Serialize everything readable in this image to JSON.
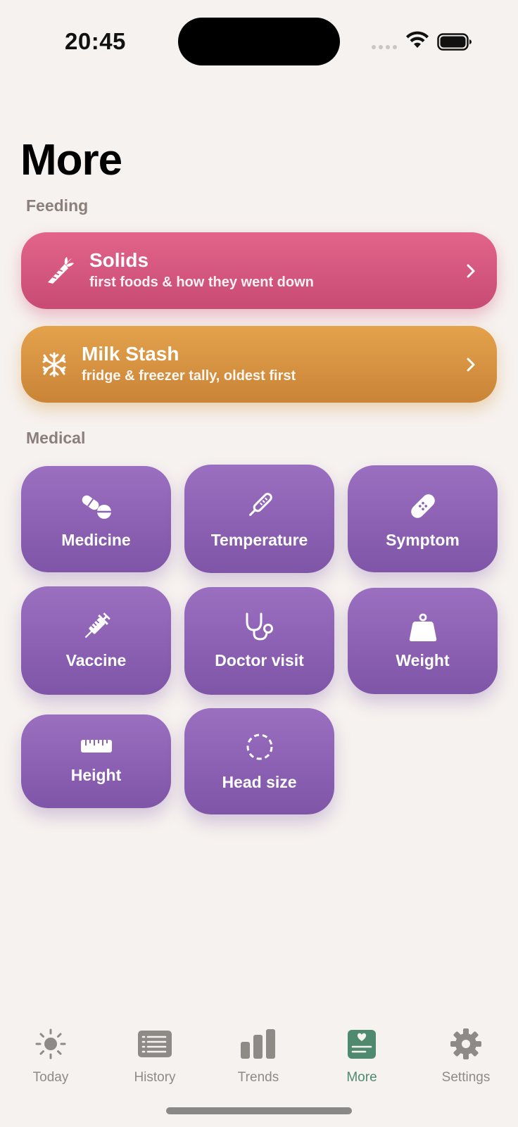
{
  "status_bar": {
    "time": "20:45"
  },
  "page": {
    "title": "More"
  },
  "feeding": {
    "header": "Feeding",
    "cards": [
      {
        "title": "Solids",
        "subtitle": "first foods & how they went down",
        "icon": "carrot-icon",
        "color": "#d9587f"
      },
      {
        "title": "Milk Stash",
        "subtitle": "fridge & freezer tally, oldest first",
        "icon": "snowflake-icon",
        "color": "#d9953f"
      }
    ]
  },
  "medical": {
    "header": "Medical",
    "color": "#8d62b5",
    "tiles": [
      {
        "label": "Medicine",
        "icon": "pills-icon"
      },
      {
        "label": "Temperature",
        "icon": "thermometer-icon"
      },
      {
        "label": "Symptom",
        "icon": "bandage-icon"
      },
      {
        "label": "Vaccine",
        "icon": "syringe-icon"
      },
      {
        "label": "Doctor visit",
        "icon": "stethoscope-icon"
      },
      {
        "label": "Weight",
        "icon": "scale-weight-icon"
      },
      {
        "label": "Height",
        "icon": "ruler-icon"
      },
      {
        "label": "Head size",
        "icon": "dashed-circle-icon"
      }
    ]
  },
  "tab_bar": {
    "active": "More",
    "active_color": "#4f8a6f",
    "tabs": [
      {
        "label": "Today",
        "icon": "sun-icon"
      },
      {
        "label": "History",
        "icon": "list-icon"
      },
      {
        "label": "Trends",
        "icon": "bar-chart-icon"
      },
      {
        "label": "More",
        "icon": "health-card-icon"
      },
      {
        "label": "Settings",
        "icon": "gear-icon"
      }
    ]
  }
}
